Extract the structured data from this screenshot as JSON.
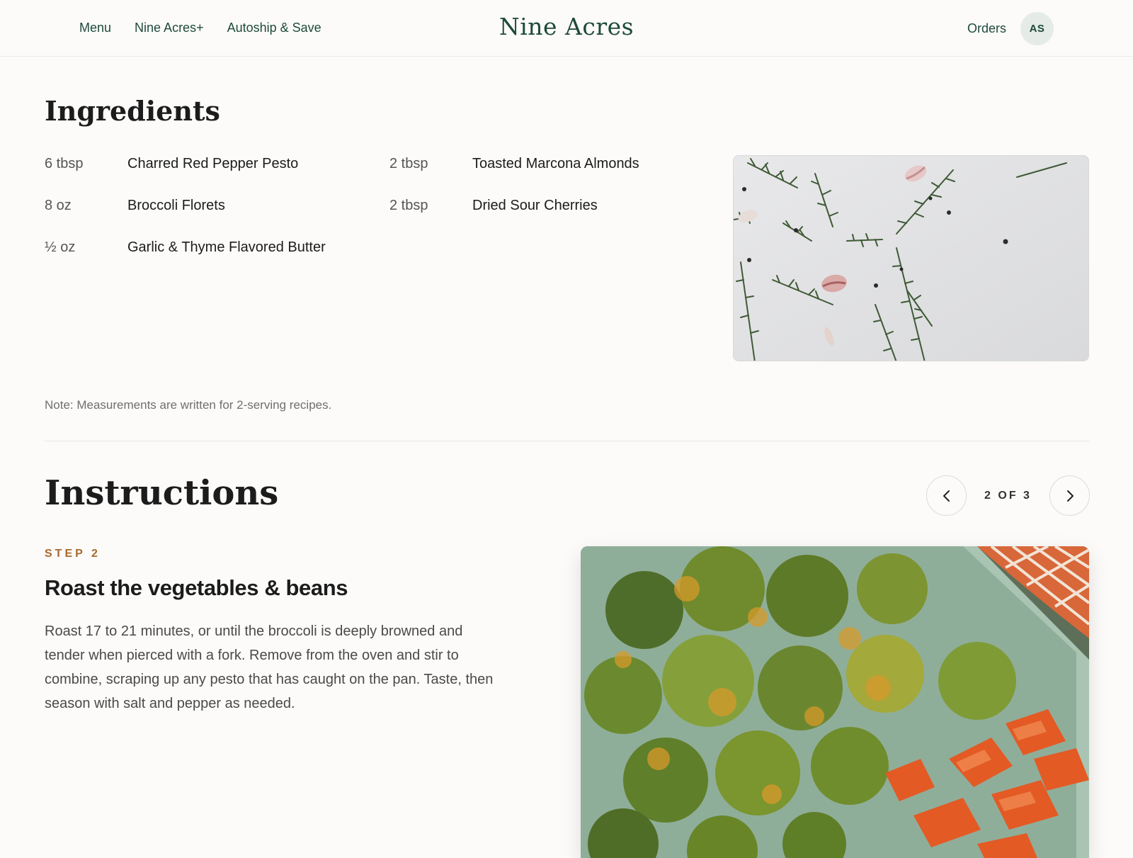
{
  "header": {
    "nav": [
      "Menu",
      "Nine Acres+",
      "Autoship & Save"
    ],
    "logo": "Nine Acres",
    "orders_label": "Orders",
    "avatar_initials": "AS"
  },
  "ingredients": {
    "title": "Ingredients",
    "col1": [
      {
        "qty": "6 tbsp",
        "name": "Charred Red Pepper Pesto"
      },
      {
        "qty": "8 oz",
        "name": "Broccoli Florets"
      },
      {
        "qty": "½ oz",
        "name": "Garlic & Thyme Flavored Butter"
      }
    ],
    "col2": [
      {
        "qty": "2 tbsp",
        "name": "Toasted Marcona Almonds"
      },
      {
        "qty": "2 tbsp",
        "name": "Dried Sour Cherries"
      }
    ],
    "note": "Note: Measurements are written for 2-serving recipes."
  },
  "instructions": {
    "title": "Instructions",
    "pager_text": "2 OF 3",
    "step_label": "STEP 2",
    "step_title": "Roast the vegetables & beans",
    "step_body": "Roast 17 to 21 minutes, or until the broccoli is deeply browned and tender when pierced with a fork. Remove from the oven and stir to combine, scraping up any pesto that has caught on the pan. Taste, then season with salt and pepper as needed."
  },
  "colors": {
    "brand_green": "#1f4a3c",
    "accent_orange": "#a8692e",
    "background": "#fcfbf9"
  },
  "icons": {
    "prev": "chevron-left-icon",
    "next": "chevron-right-icon"
  }
}
